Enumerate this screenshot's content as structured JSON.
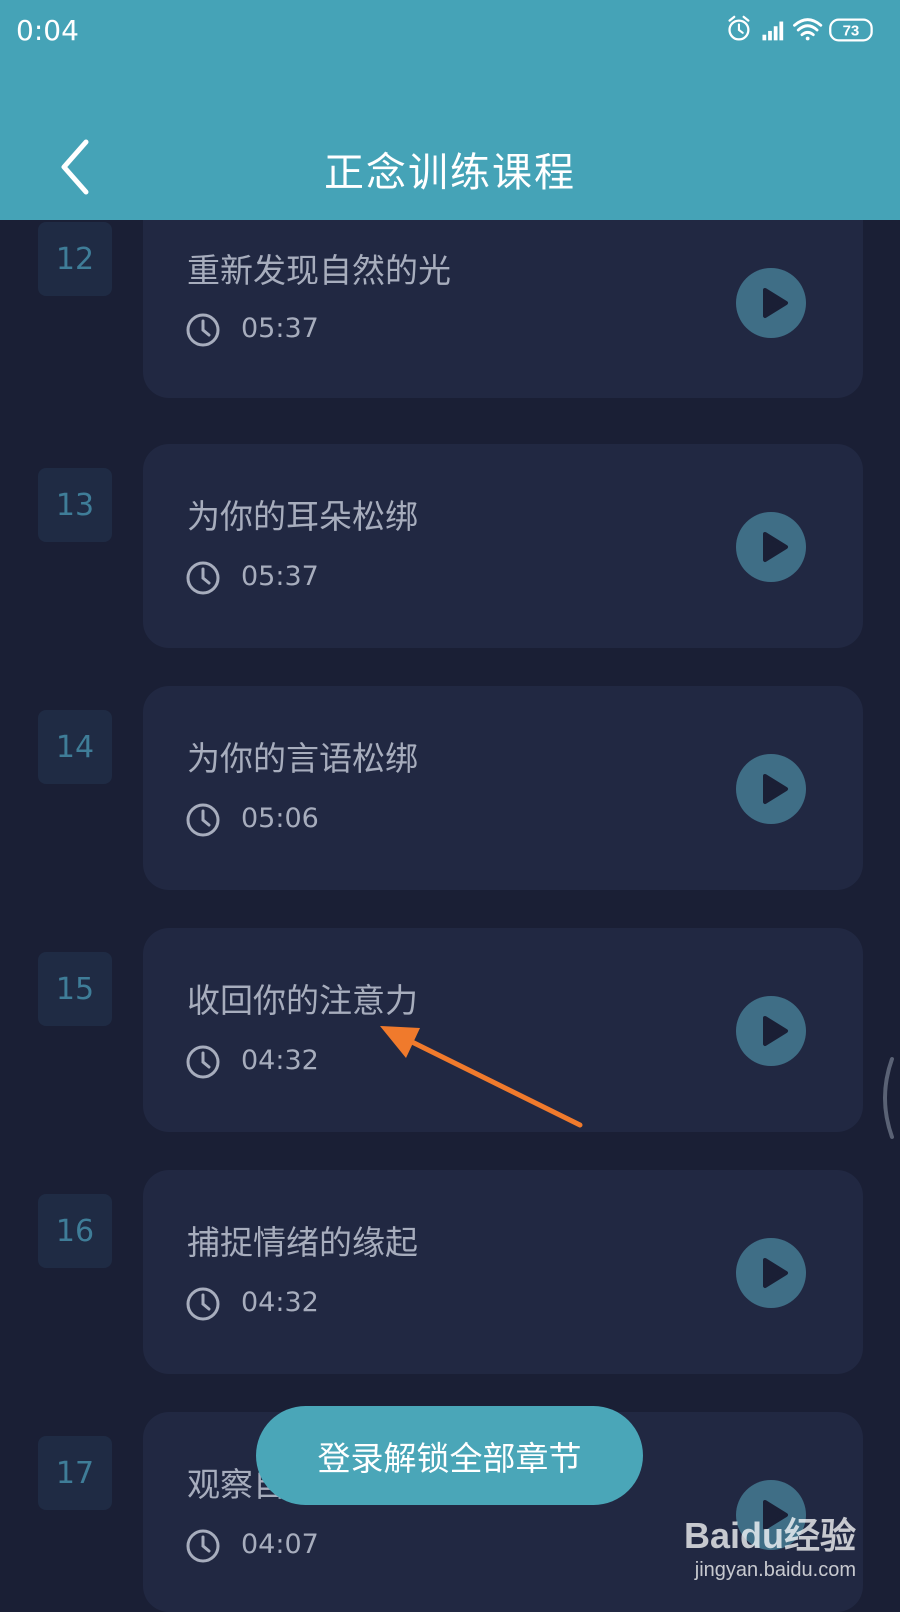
{
  "status_bar": {
    "time": "0:04",
    "battery": "73",
    "icons": [
      "alarm-icon",
      "signal-icon",
      "wifi-icon",
      "battery-icon"
    ]
  },
  "header": {
    "title": "正念训练课程",
    "back_icon": "chevron-left-icon",
    "background": "#45a3b7"
  },
  "lessons": [
    {
      "number": "12",
      "title": "重新发现自然的光",
      "duration": "05:37"
    },
    {
      "number": "13",
      "title": "为你的耳朵松绑",
      "duration": "05:37"
    },
    {
      "number": "14",
      "title": "为你的言语松绑",
      "duration": "05:06"
    },
    {
      "number": "15",
      "title": "收回你的注意力",
      "duration": "04:32"
    },
    {
      "number": "16",
      "title": "捕捉情绪的缘起",
      "duration": "04:32"
    },
    {
      "number": "17",
      "title": "观察自",
      "duration": "04:07"
    }
  ],
  "unlock_button": {
    "label": "登录解锁全部章节"
  },
  "watermark": {
    "logo": "Baidu经验",
    "url": "jingyan.baidu.com"
  },
  "colors": {
    "background": "#1a1f35",
    "card": "#212842",
    "accent": "#45a3b7",
    "play_button": "#3f6e86",
    "annotation_arrow": "#f07a2c"
  }
}
